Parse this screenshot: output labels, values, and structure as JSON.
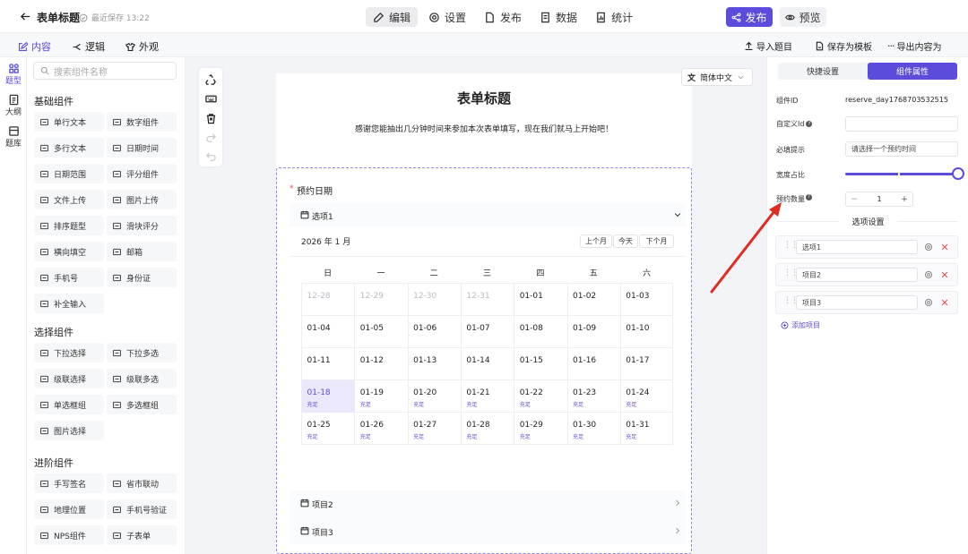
{
  "header": {
    "title": "表单标题",
    "save_status": "最近保存 13:22",
    "tabs": [
      {
        "label": "编辑"
      },
      {
        "label": "设置"
      },
      {
        "label": "发布"
      },
      {
        "label": "数据"
      },
      {
        "label": "统计"
      }
    ],
    "publish_label": "发布",
    "preview_label": "预览"
  },
  "subbar": {
    "tabs": [
      {
        "label": "内容"
      },
      {
        "label": "逻辑"
      },
      {
        "label": "外观"
      }
    ],
    "actions": [
      {
        "label": "导入题目"
      },
      {
        "label": "保存为模板"
      },
      {
        "label": "导出内容为"
      }
    ]
  },
  "leftnav": [
    {
      "label": "题型"
    },
    {
      "label": "大纲"
    },
    {
      "label": "题库"
    }
  ],
  "panel": {
    "search_placeholder": "搜索组件名称",
    "groups": [
      {
        "title": "基础组件",
        "items": [
          {
            "label": "单行文本",
            "icon": "text-input-icon"
          },
          {
            "label": "数字组件",
            "icon": "number-icon"
          },
          {
            "label": "多行文本",
            "icon": "textarea-icon"
          },
          {
            "label": "日期时间",
            "icon": "calendar-icon"
          },
          {
            "label": "日期范围",
            "icon": "date-range-icon"
          },
          {
            "label": "评分组件",
            "icon": "star-icon"
          },
          {
            "label": "文件上传",
            "icon": "upload-icon"
          },
          {
            "label": "图片上传",
            "icon": "image-icon"
          },
          {
            "label": "排序题型",
            "icon": "sort-icon"
          },
          {
            "label": "滑块评分",
            "icon": "slider-icon"
          },
          {
            "label": "横向填空",
            "icon": "fill-blank-icon"
          },
          {
            "label": "邮箱",
            "icon": "mail-icon"
          },
          {
            "label": "手机号",
            "icon": "phone-icon"
          },
          {
            "label": "身份证",
            "icon": "id-card-icon"
          },
          {
            "label": "补全输入",
            "icon": "autocomplete-icon"
          }
        ]
      },
      {
        "title": "选择组件",
        "items": [
          {
            "label": "下拉选择",
            "icon": "dropdown-icon"
          },
          {
            "label": "下拉多选",
            "icon": "multi-dropdown-icon"
          },
          {
            "label": "级联选择",
            "icon": "cascade-icon"
          },
          {
            "label": "级联多选",
            "icon": "cascade-multi-icon"
          },
          {
            "label": "单选框组",
            "icon": "radio-icon"
          },
          {
            "label": "多选框组",
            "icon": "checkbox-icon"
          },
          {
            "label": "图片选择",
            "icon": "image-select-icon"
          }
        ]
      },
      {
        "title": "进阶组件",
        "items": [
          {
            "label": "手写签名",
            "icon": "signature-icon"
          },
          {
            "label": "省市联动",
            "icon": "city-icon"
          },
          {
            "label": "地理位置",
            "icon": "location-icon"
          },
          {
            "label": "手机号验证",
            "icon": "phone-verify-icon"
          },
          {
            "label": "NPS组件",
            "icon": "nps-icon"
          },
          {
            "label": "子表单",
            "icon": "subform-icon"
          }
        ]
      }
    ]
  },
  "form": {
    "title": "表单标题",
    "description": "感谢您能抽出几分钟时间来参加本次表单填写，现在我们就马上开始吧！",
    "language": "简体中文",
    "field_label": "预约日期",
    "required_mark": "*",
    "option1": "选项1",
    "option2": "项目2",
    "option3": "项目3",
    "month_title": "2026 年 1 月",
    "prev_month": "上个月",
    "today": "今天",
    "next_month": "下个月",
    "weekdays": [
      "日",
      "一",
      "二",
      "三",
      "四",
      "五",
      "六"
    ],
    "weeks": [
      [
        {
          "d": "12-28",
          "past": true
        },
        {
          "d": "12-29",
          "past": true
        },
        {
          "d": "12-30",
          "past": true
        },
        {
          "d": "12-31",
          "past": true
        },
        {
          "d": "01-01"
        },
        {
          "d": "01-02"
        },
        {
          "d": "01-03"
        }
      ],
      [
        {
          "d": "01-04"
        },
        {
          "d": "01-05"
        },
        {
          "d": "01-06"
        },
        {
          "d": "01-07"
        },
        {
          "d": "01-08"
        },
        {
          "d": "01-09"
        },
        {
          "d": "01-10"
        }
      ],
      [
        {
          "d": "01-11"
        },
        {
          "d": "01-12"
        },
        {
          "d": "01-13"
        },
        {
          "d": "01-14"
        },
        {
          "d": "01-15"
        },
        {
          "d": "01-16"
        },
        {
          "d": "01-17"
        }
      ],
      [
        {
          "d": "01-18",
          "s": "充足",
          "sel": true
        },
        {
          "d": "01-19",
          "s": "充足"
        },
        {
          "d": "01-20",
          "s": "充足"
        },
        {
          "d": "01-21",
          "s": "充足"
        },
        {
          "d": "01-22",
          "s": "充足"
        },
        {
          "d": "01-23",
          "s": "充足"
        },
        {
          "d": "01-24",
          "s": "充足"
        }
      ],
      [
        {
          "d": "01-25",
          "s": "充足"
        },
        {
          "d": "01-26",
          "s": "充足"
        },
        {
          "d": "01-27",
          "s": "充足"
        },
        {
          "d": "01-28",
          "s": "充足"
        },
        {
          "d": "01-29",
          "s": "充足"
        },
        {
          "d": "01-30",
          "s": "充足"
        },
        {
          "d": "01-31",
          "s": "充足"
        }
      ]
    ]
  },
  "props": {
    "tab_quick": "快捷设置",
    "tab_props": "组件属性",
    "id_label": "组件ID",
    "id_value": "reserve_day1768703532515",
    "custom_id_label": "自定义Id",
    "required_tip_label": "必填提示",
    "required_tip_value": "请选择一个预约时间",
    "width_label": "宽度占比",
    "width_fraction": 1.0,
    "count_label": "预约数量",
    "count_value": "1",
    "minus": "−",
    "plus": "+",
    "options_title": "选项设置",
    "options": [
      {
        "label": "选项1"
      },
      {
        "label": "项目2"
      },
      {
        "label": "项目3"
      }
    ],
    "add_label": "添加项目"
  },
  "colors": {
    "accent": "#5b4cdb",
    "annotation_arrow": "#e02b20"
  }
}
